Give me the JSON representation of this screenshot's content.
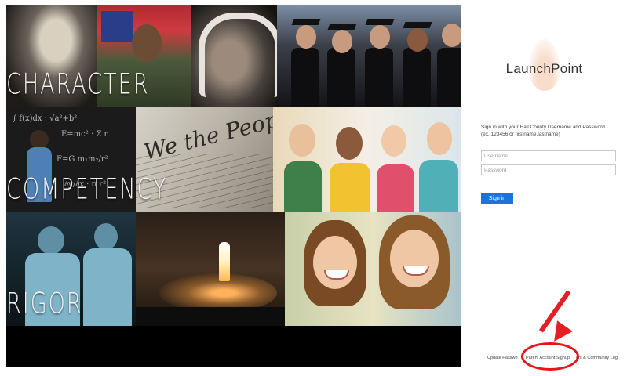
{
  "collage": {
    "bands": [
      "CHARACTER",
      "COMPETENCY",
      "RIGOR"
    ],
    "constitution_script": "We the People"
  },
  "login": {
    "logo_text": "LaunchPoint",
    "prompt_line1": "Sign in with your Hall County Username and Password",
    "prompt_line2": "(ex. 123456 or firstname.lastname)",
    "username_placeholder": "Username",
    "password_placeholder": "Password",
    "signin_label": "Sign in"
  },
  "footer": {
    "update_password": "Update Passwo",
    "parent_signup": "Parent Account Signup",
    "community_login": "ent & Community Logi"
  },
  "annotation": {
    "color": "#e31e24"
  }
}
